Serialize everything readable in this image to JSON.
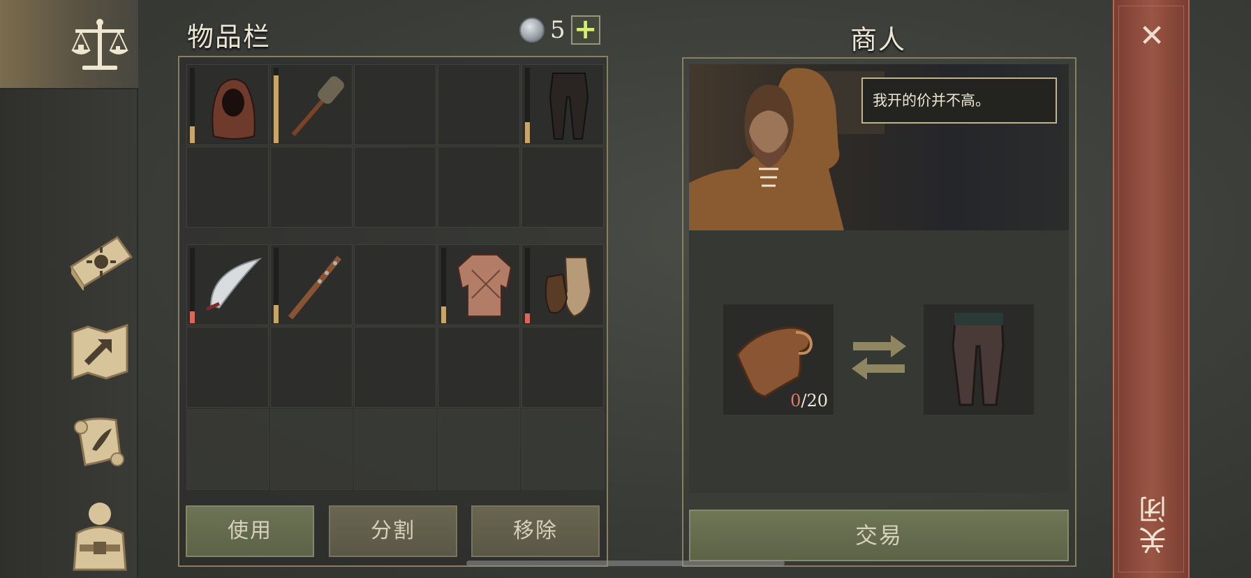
{
  "inventory": {
    "title": "物品栏",
    "coin_count": "5",
    "add_label": "+",
    "grid_top": [
      {
        "item": "hood",
        "durability": 0.22,
        "dur_color": "#c9a56a"
      },
      {
        "item": "wooden-club",
        "durability": 0.9,
        "dur_color": "#c9a56a"
      },
      {
        "item": "",
        "durability": 0
      },
      {
        "item": "",
        "durability": 0
      },
      {
        "item": "pants",
        "durability": 0.28,
        "dur_color": "#c9a56a"
      },
      {
        "item": ""
      },
      {
        "item": ""
      },
      {
        "item": ""
      },
      {
        "item": ""
      },
      {
        "item": ""
      }
    ],
    "grid_bottom": [
      {
        "item": "scimitar",
        "durability": 0.16,
        "dur_color": "#d9695a"
      },
      {
        "item": "spiked-club",
        "durability": 0.24,
        "dur_color": "#c9a56a"
      },
      {
        "item": "",
        "durability": 0
      },
      {
        "item": "quilted-jacket",
        "durability": 0.22,
        "dur_color": "#c9a56a"
      },
      {
        "item": "leather-gloves",
        "durability": 0.13,
        "dur_color": "#d9695a"
      },
      {
        "item": ""
      },
      {
        "item": ""
      },
      {
        "item": ""
      },
      {
        "item": ""
      },
      {
        "item": ""
      },
      {
        "item": ""
      },
      {
        "item": ""
      },
      {
        "item": ""
      },
      {
        "item": ""
      },
      {
        "item": ""
      }
    ],
    "buttons": {
      "use": "使用",
      "split": "分割",
      "remove": "移除"
    }
  },
  "merchant": {
    "title": "商人",
    "speech": "我开的价并不高。",
    "offer_count_have": "0",
    "offer_count_need": "/20",
    "trade_label": "交易"
  },
  "close": {
    "label": "关闭",
    "x": "✕"
  },
  "colors": {
    "accent_gold": "#8b7f60",
    "close_red": "#9a5544",
    "btn_green": "#6d7355"
  }
}
